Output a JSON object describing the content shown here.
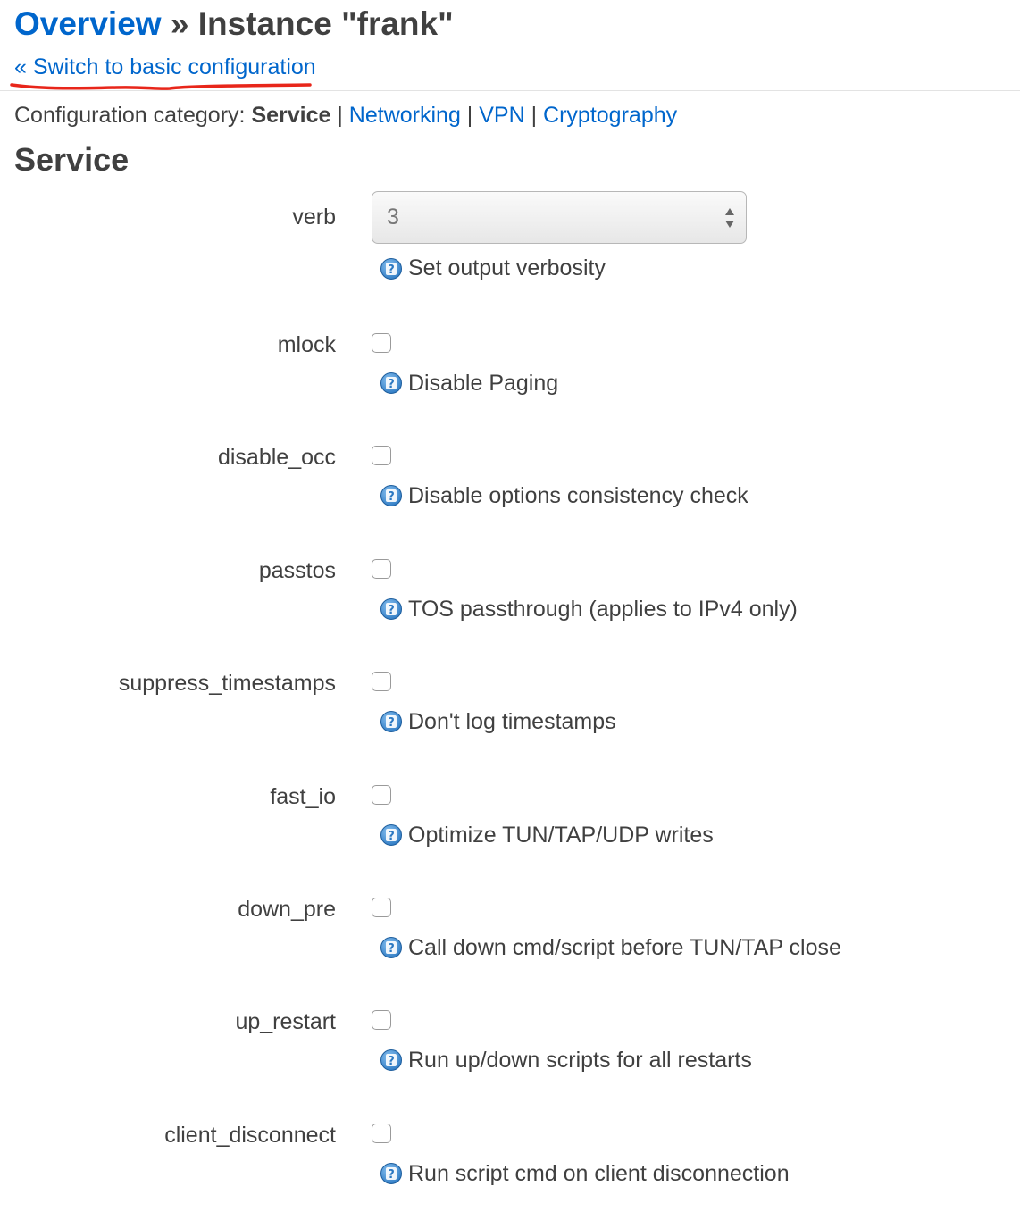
{
  "header": {
    "breadcrumb_link": "Overview",
    "breadcrumb_sep": " » ",
    "breadcrumb_current": "Instance \"frank\"",
    "switch_link": "« Switch to basic configuration",
    "annotation_color": "#e8261a"
  },
  "category": {
    "prefix": "Configuration category: ",
    "current": "Service",
    "separator": " | ",
    "links": [
      "Networking",
      "VPN",
      "Cryptography"
    ]
  },
  "section_title": "Service",
  "verb": {
    "label": "verb",
    "value": "3",
    "help": "Set output verbosity"
  },
  "options": [
    {
      "label": "mlock",
      "help": "Disable Paging",
      "checked": false
    },
    {
      "label": "disable_occ",
      "help": "Disable options consistency check",
      "checked": false
    },
    {
      "label": "passtos",
      "help": "TOS passthrough (applies to IPv4 only)",
      "checked": false
    },
    {
      "label": "suppress_timestamps",
      "help": "Don't log timestamps",
      "checked": false
    },
    {
      "label": "fast_io",
      "help": "Optimize TUN/TAP/UDP writes",
      "checked": false
    },
    {
      "label": "down_pre",
      "help": "Call down cmd/script before TUN/TAP close",
      "checked": false
    },
    {
      "label": "up_restart",
      "help": "Run up/down scripts for all restarts",
      "checked": false
    },
    {
      "label": "client_disconnect",
      "help": "Run script cmd on client disconnection",
      "checked": false
    }
  ],
  "colors": {
    "link": "#0066cc",
    "text": "#404040",
    "help_icon": "#3b8fd6"
  },
  "icons": {
    "help": "question-help-icon",
    "select": "updown-arrows-icon"
  }
}
